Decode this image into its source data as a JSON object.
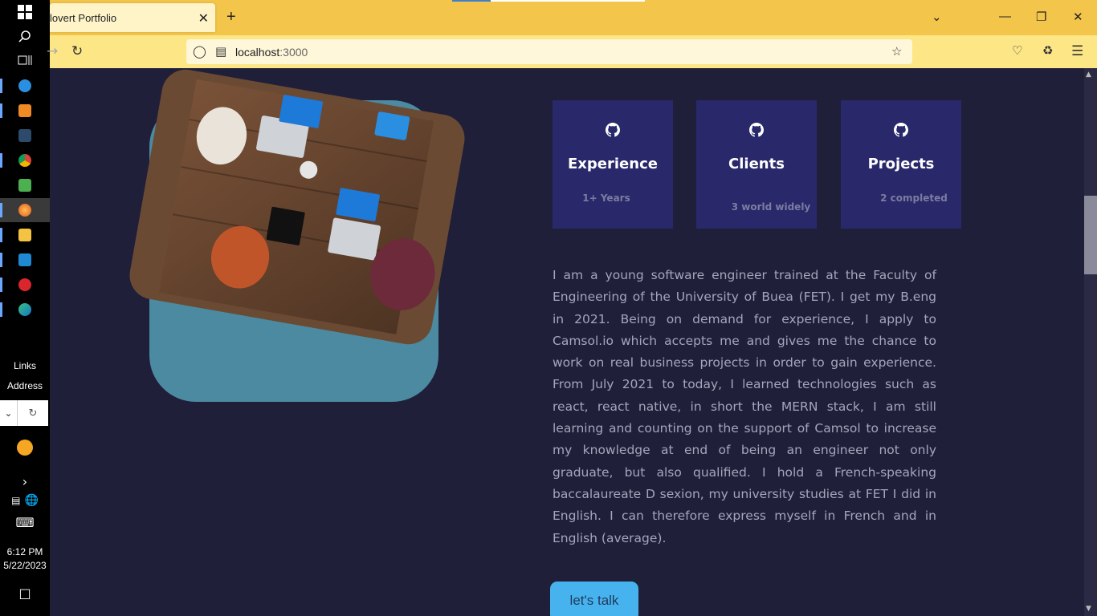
{
  "taskbar": {
    "links_label": "Links",
    "address_label": "Address",
    "time": "6:12 PM",
    "date": "5/22/2023"
  },
  "browser": {
    "tab_title": "lovert Portfolio",
    "url_host": "localhost",
    "url_port": ":3000"
  },
  "cards": [
    {
      "title": "Experience",
      "subtitle": "1+ Years",
      "icon": "github-icon"
    },
    {
      "title": "Clients",
      "subtitle": "3 world widely",
      "icon": "github-icon"
    },
    {
      "title": "Projects",
      "subtitle": "2 completed",
      "icon": "github-icon"
    }
  ],
  "about": {
    "text": "I am a young software engineer trained at the Faculty of Engineering of the University of Buea (FET). I get my B.eng in 2021. Being on demand for experience, I apply to Camsol.io which accepts me and gives me the chance to work on real business projects in order to gain experience. From July 2021 to today, I learned technologies such as react, react native, in short the MERN stack, I am still learning and counting on the support of Camsol to increase my knowledge at end of being an engineer not only graduate, but also qualified. I hold a French-speaking baccalaureate D sexion, my university studies at FET I did in English. I can therefore express myself in French and in English (average)."
  },
  "cta": {
    "label": "let's talk"
  },
  "colors": {
    "page_bg": "#1f1f3a",
    "card_bg": "#29286b",
    "image_frame": "#4b8aa0",
    "button": "#47b3ee",
    "titlebar": "#f3c54b"
  }
}
